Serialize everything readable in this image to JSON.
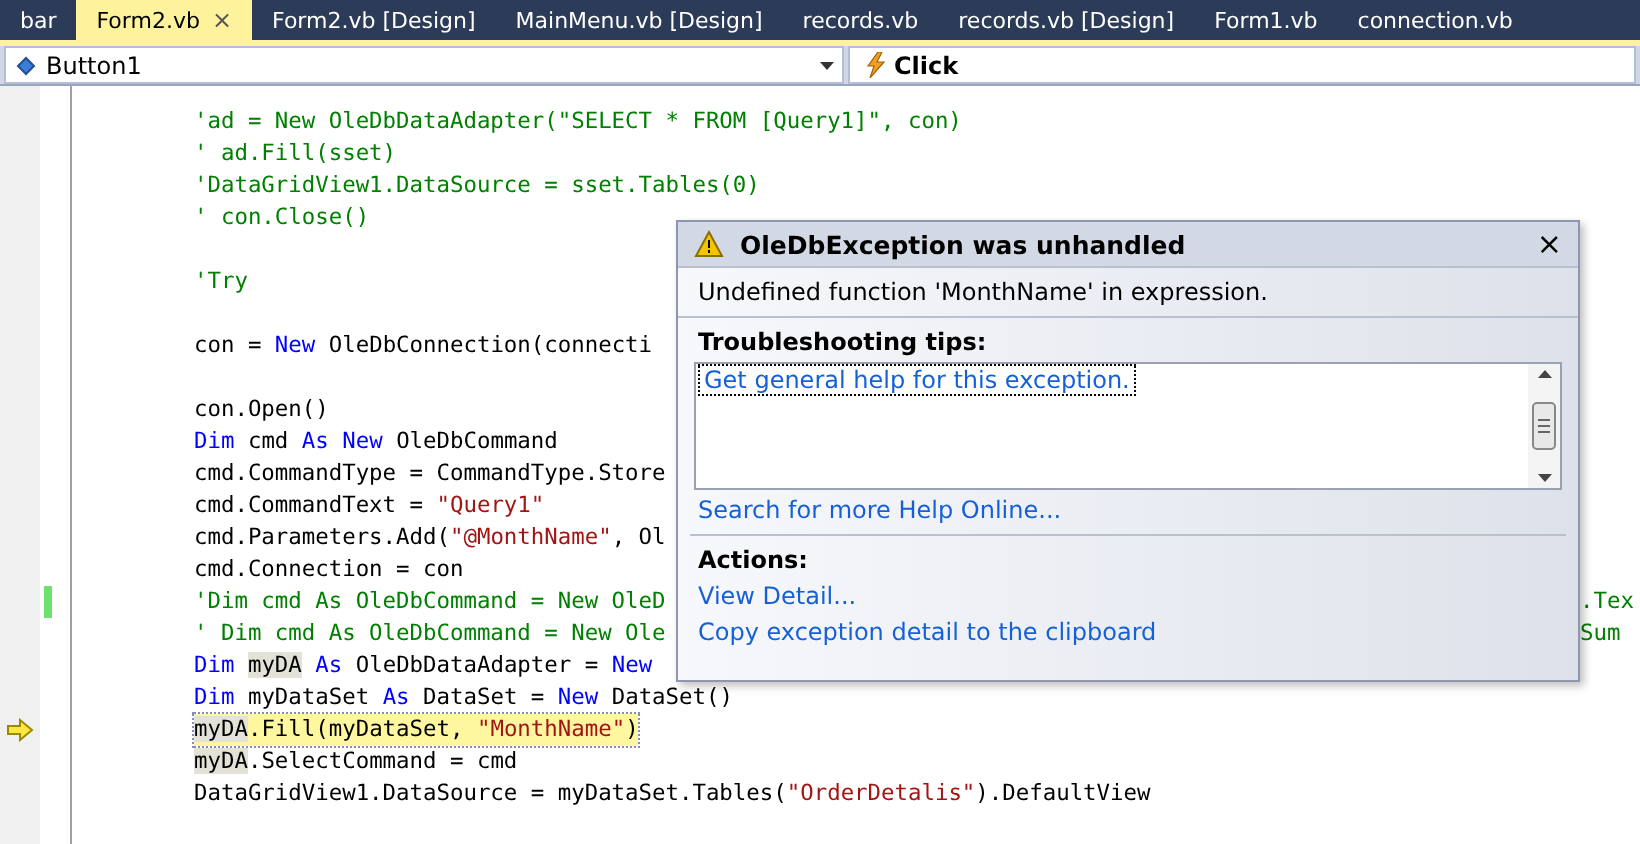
{
  "tabs": [
    {
      "label": "bar",
      "selected": false
    },
    {
      "label": "Form2.vb",
      "selected": true
    },
    {
      "label": "Form2.vb [Design]",
      "selected": false
    },
    {
      "label": "MainMenu.vb [Design]",
      "selected": false
    },
    {
      "label": "records.vb",
      "selected": false
    },
    {
      "label": "records.vb [Design]",
      "selected": false
    },
    {
      "label": "Form1.vb",
      "selected": false
    },
    {
      "label": "connection.vb",
      "selected": false
    }
  ],
  "tab_close": "×",
  "class_dropdown": {
    "value": "Button1"
  },
  "method_dropdown": {
    "value": "Click"
  },
  "code_blocks": [
    {
      "lines": [
        {
          "current": false,
          "changed": false,
          "tokens": [
            {
              "kind": "comment",
              "t": "'ad = New OleDbDataAdapter(\"SELECT * FROM [Query1]\", con)"
            }
          ]
        },
        {
          "current": false,
          "changed": false,
          "tokens": [
            {
              "kind": "comment",
              "t": "' ad.Fill(sset)"
            }
          ]
        },
        {
          "current": false,
          "changed": false,
          "tokens": [
            {
              "kind": "comment",
              "t": "'DataGridView1.DataSource = sset.Tables(0)"
            }
          ]
        },
        {
          "current": false,
          "changed": false,
          "tokens": [
            {
              "kind": "comment",
              "t": "' con.Close()"
            }
          ]
        }
      ]
    },
    {
      "lines": [
        {
          "current": false,
          "changed": false,
          "tokens": [
            {
              "kind": "comment",
              "t": "'Try"
            }
          ]
        }
      ]
    },
    {
      "lines": [
        {
          "current": false,
          "changed": false,
          "tokens": [
            {
              "kind": "plain",
              "t": "con = "
            },
            {
              "kind": "keyword",
              "t": "New"
            },
            {
              "kind": "plain",
              "t": " OleDbConnection(connecti"
            }
          ]
        }
      ]
    },
    {
      "lines": [
        {
          "current": false,
          "changed": false,
          "tokens": [
            {
              "kind": "plain",
              "t": "con.Open()"
            }
          ]
        },
        {
          "current": false,
          "changed": false,
          "tokens": [
            {
              "kind": "keyword",
              "t": "Dim "
            },
            {
              "kind": "plain",
              "t": "cmd "
            },
            {
              "kind": "keyword",
              "t": "As New "
            },
            {
              "kind": "plain",
              "t": "OleDbCommand"
            }
          ]
        },
        {
          "current": false,
          "changed": false,
          "tokens": [
            {
              "kind": "plain",
              "t": "cmd.CommandType = CommandType.Store"
            }
          ]
        },
        {
          "current": false,
          "changed": false,
          "tokens": [
            {
              "kind": "plain",
              "t": "cmd.CommandText = "
            },
            {
              "kind": "string",
              "t": "\"Query1\""
            }
          ]
        },
        {
          "current": false,
          "changed": false,
          "tokens": [
            {
              "kind": "plain",
              "t": "cmd.Parameters.Add("
            },
            {
              "kind": "string",
              "t": "\"@MonthName\""
            },
            {
              "kind": "plain",
              "t": ", Ol"
            }
          ]
        },
        {
          "current": false,
          "changed": false,
          "tokens": [
            {
              "kind": "plain",
              "t": "cmd.Connection = con"
            }
          ]
        },
        {
          "current": false,
          "changed": true,
          "tokens": [
            {
              "kind": "comment",
              "t": "'Dim cmd As OleDbCommand = New OleD"
            }
          ],
          "tail": ".Tex"
        },
        {
          "current": false,
          "changed": false,
          "tokens": [
            {
              "kind": "comment",
              "t": "' Dim cmd As OleDbCommand = New Ole"
            }
          ],
          "tail": "Sum"
        },
        {
          "current": false,
          "changed": false,
          "tokens": [
            {
              "kind": "keyword",
              "t": "Dim "
            },
            {
              "kind": "reference",
              "t": "myDA"
            },
            {
              "kind": "keyword",
              "t": " As "
            },
            {
              "kind": "plain",
              "t": "OleDbDataAdapter = "
            },
            {
              "kind": "keyword",
              "t": "New"
            }
          ]
        },
        {
          "current": false,
          "changed": false,
          "tokens": [
            {
              "kind": "keyword",
              "t": "Dim "
            },
            {
              "kind": "plain",
              "t": "myDataSet "
            },
            {
              "kind": "keyword",
              "t": "As "
            },
            {
              "kind": "plain",
              "t": "DataSet = "
            },
            {
              "kind": "keyword",
              "t": "New "
            },
            {
              "kind": "plain",
              "t": "DataSet()"
            }
          ]
        },
        {
          "current": true,
          "changed": false,
          "tokens": [
            {
              "kind": "reference",
              "t": "myDA"
            },
            {
              "kind": "plain",
              "t": ".Fill(myDataSet, "
            },
            {
              "kind": "string",
              "t": "\"MonthName\""
            },
            {
              "kind": "plain",
              "t": ")"
            }
          ]
        },
        {
          "current": false,
          "changed": false,
          "tokens": [
            {
              "kind": "reference",
              "t": "myDA"
            },
            {
              "kind": "plain",
              "t": ".SelectCommand = cmd"
            }
          ]
        },
        {
          "current": false,
          "changed": false,
          "tokens": [
            {
              "kind": "plain",
              "t": "DataGridView1.DataSource = myDataSet.Tables("
            },
            {
              "kind": "string",
              "t": "\"OrderDetalis\""
            },
            {
              "kind": "plain",
              "t": ").DefaultView"
            }
          ]
        }
      ]
    }
  ],
  "exception_popup": {
    "title": "OleDbException was unhandled",
    "close": "×",
    "message": "Undefined function 'MonthName' in expression.",
    "tips_heading": "Troubleshooting tips:",
    "tips": [
      "Get general help for this exception."
    ],
    "search_link": "Search for more Help Online...",
    "actions_heading": "Actions:",
    "actions": [
      "View Detail...",
      "Copy exception detail to the clipboard"
    ]
  }
}
